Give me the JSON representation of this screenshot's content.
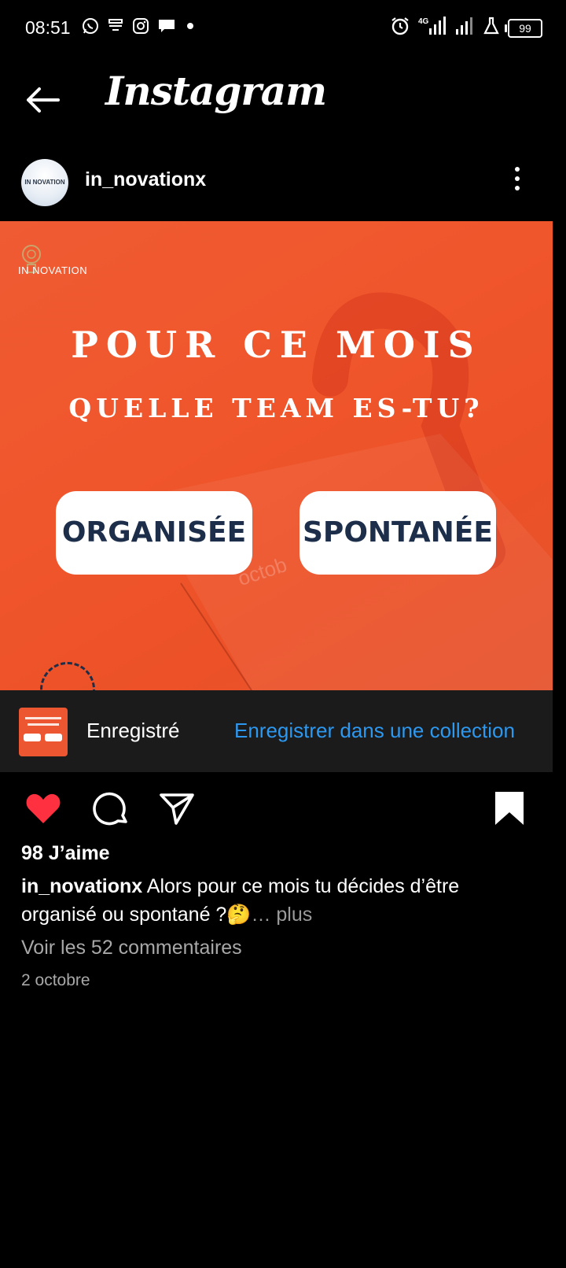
{
  "status_bar": {
    "time": "08:51",
    "battery": "99",
    "network": "4G"
  },
  "header": {
    "title": "Instagram"
  },
  "post": {
    "username": "in_novationx",
    "avatar_text": "IN NOVATION",
    "image": {
      "logo_text": "IN NOVATION",
      "headline_1": "POUR CE MOIS",
      "headline_2": "QUELLE TEAM ES-TU?",
      "option_left": "ORGANISÉE",
      "option_right": "SPONTANÉE",
      "background_text": "octob"
    },
    "saved_bar": {
      "label": "Enregistré",
      "link": "Enregistrer dans une collection"
    },
    "likes": "98 J’aime",
    "caption_user": "in_novationx",
    "caption_text": "Alors pour ce mois tu décides d’être organisé ou spontané ?🤔",
    "caption_more": "… plus",
    "comments_link": "Voir les 52 commentaires",
    "date": "2 octobre"
  },
  "colors": {
    "accent_blue": "#2c98f0",
    "like_red": "#ff3040",
    "post_orange": "#ef5b33",
    "button_text": "#1c2e4a"
  },
  "icons": [
    "whatsapp-icon",
    "notification-icon",
    "instagram-icon",
    "message-icon",
    "alarm-icon",
    "signal-icon",
    "lab-icon",
    "battery-icon",
    "back-arrow-icon",
    "more-vertical-icon",
    "heart-icon",
    "comment-icon",
    "share-icon",
    "bookmark-icon"
  ]
}
